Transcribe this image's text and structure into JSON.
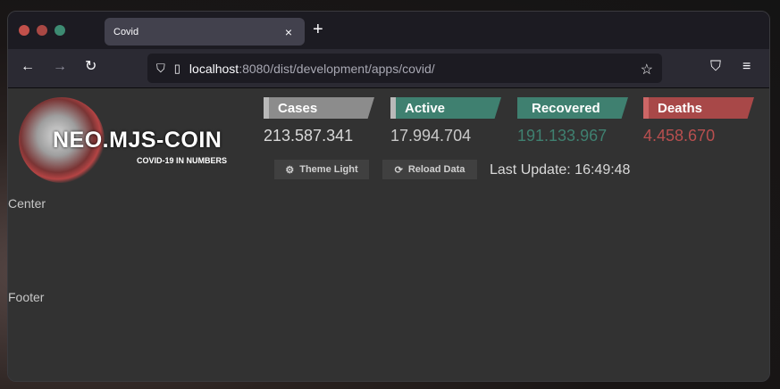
{
  "browser": {
    "tab_title": "Covid",
    "tab_close_icon": "×",
    "new_tab_icon": "+",
    "back_icon": "←",
    "forward_icon": "→",
    "reload_icon": "↻",
    "shield_icon": "⛉",
    "page_icon": "▯",
    "url_host": "localhost",
    "url_path": ":8080/dist/development/apps/covid/",
    "bookmark_icon": "☆",
    "pocket_icon": "⛉",
    "menu_icon": "≡"
  },
  "header": {
    "logo_title": "NEO.MJS-COIN",
    "logo_subtitle": "COVID-19 IN NUMBERS",
    "stats": {
      "cases": {
        "label": "Cases",
        "value": "213.587.341"
      },
      "active": {
        "label": "Active",
        "value": "17.994.704"
      },
      "recovered": {
        "label": "Recovered",
        "value": "191.133.967"
      },
      "deaths": {
        "label": "Deaths",
        "value": "4.458.670"
      }
    },
    "theme_button": {
      "icon": "⚙",
      "label": "Theme Light"
    },
    "reload_button": {
      "icon": "⟳",
      "label": "Reload Data"
    },
    "last_update": "Last Update: 16:49:48"
  },
  "regions": {
    "center": "Center",
    "footer": "Footer"
  },
  "colors": {
    "cases": "#8c8c8c",
    "active": "#3f8070",
    "recovered": "#3f8070",
    "deaths": "#a84848"
  }
}
